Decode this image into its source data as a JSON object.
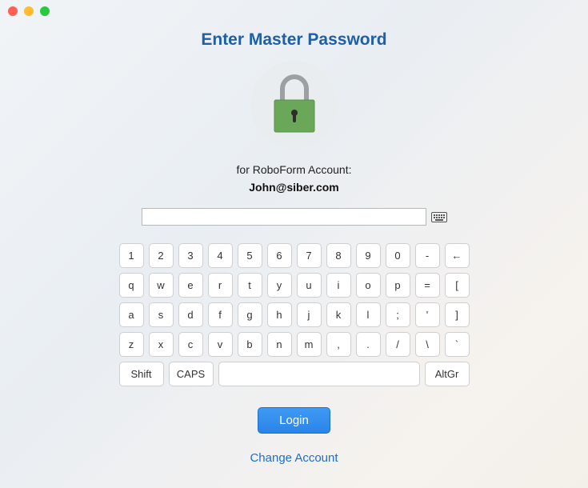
{
  "window": {
    "traffic": [
      "close",
      "minimize",
      "maximize"
    ]
  },
  "header": {
    "title": "Enter Master Password",
    "account_label": "for RoboForm Account:",
    "account_email": "John@siber.com"
  },
  "password": {
    "value": "",
    "placeholder": ""
  },
  "icons": {
    "keyboard": "keyboard-icon",
    "lock": "lock-icon"
  },
  "keyboard": {
    "row1": [
      "1",
      "2",
      "3",
      "4",
      "5",
      "6",
      "7",
      "8",
      "9",
      "0",
      "-",
      "←"
    ],
    "row2": [
      "q",
      "w",
      "e",
      "r",
      "t",
      "y",
      "u",
      "i",
      "o",
      "p",
      "=",
      "["
    ],
    "row3": [
      "a",
      "s",
      "d",
      "f",
      "g",
      "h",
      "j",
      "k",
      "l",
      ";",
      "'",
      "]"
    ],
    "row4": [
      "z",
      "x",
      "c",
      "v",
      "b",
      "n",
      "m",
      ",",
      ".",
      "/",
      "\\",
      "`"
    ],
    "row5": {
      "shift": "Shift",
      "caps": "CAPS",
      "space": " ",
      "altgr": "AltGr"
    }
  },
  "actions": {
    "login": "Login",
    "change_account": "Change Account"
  }
}
